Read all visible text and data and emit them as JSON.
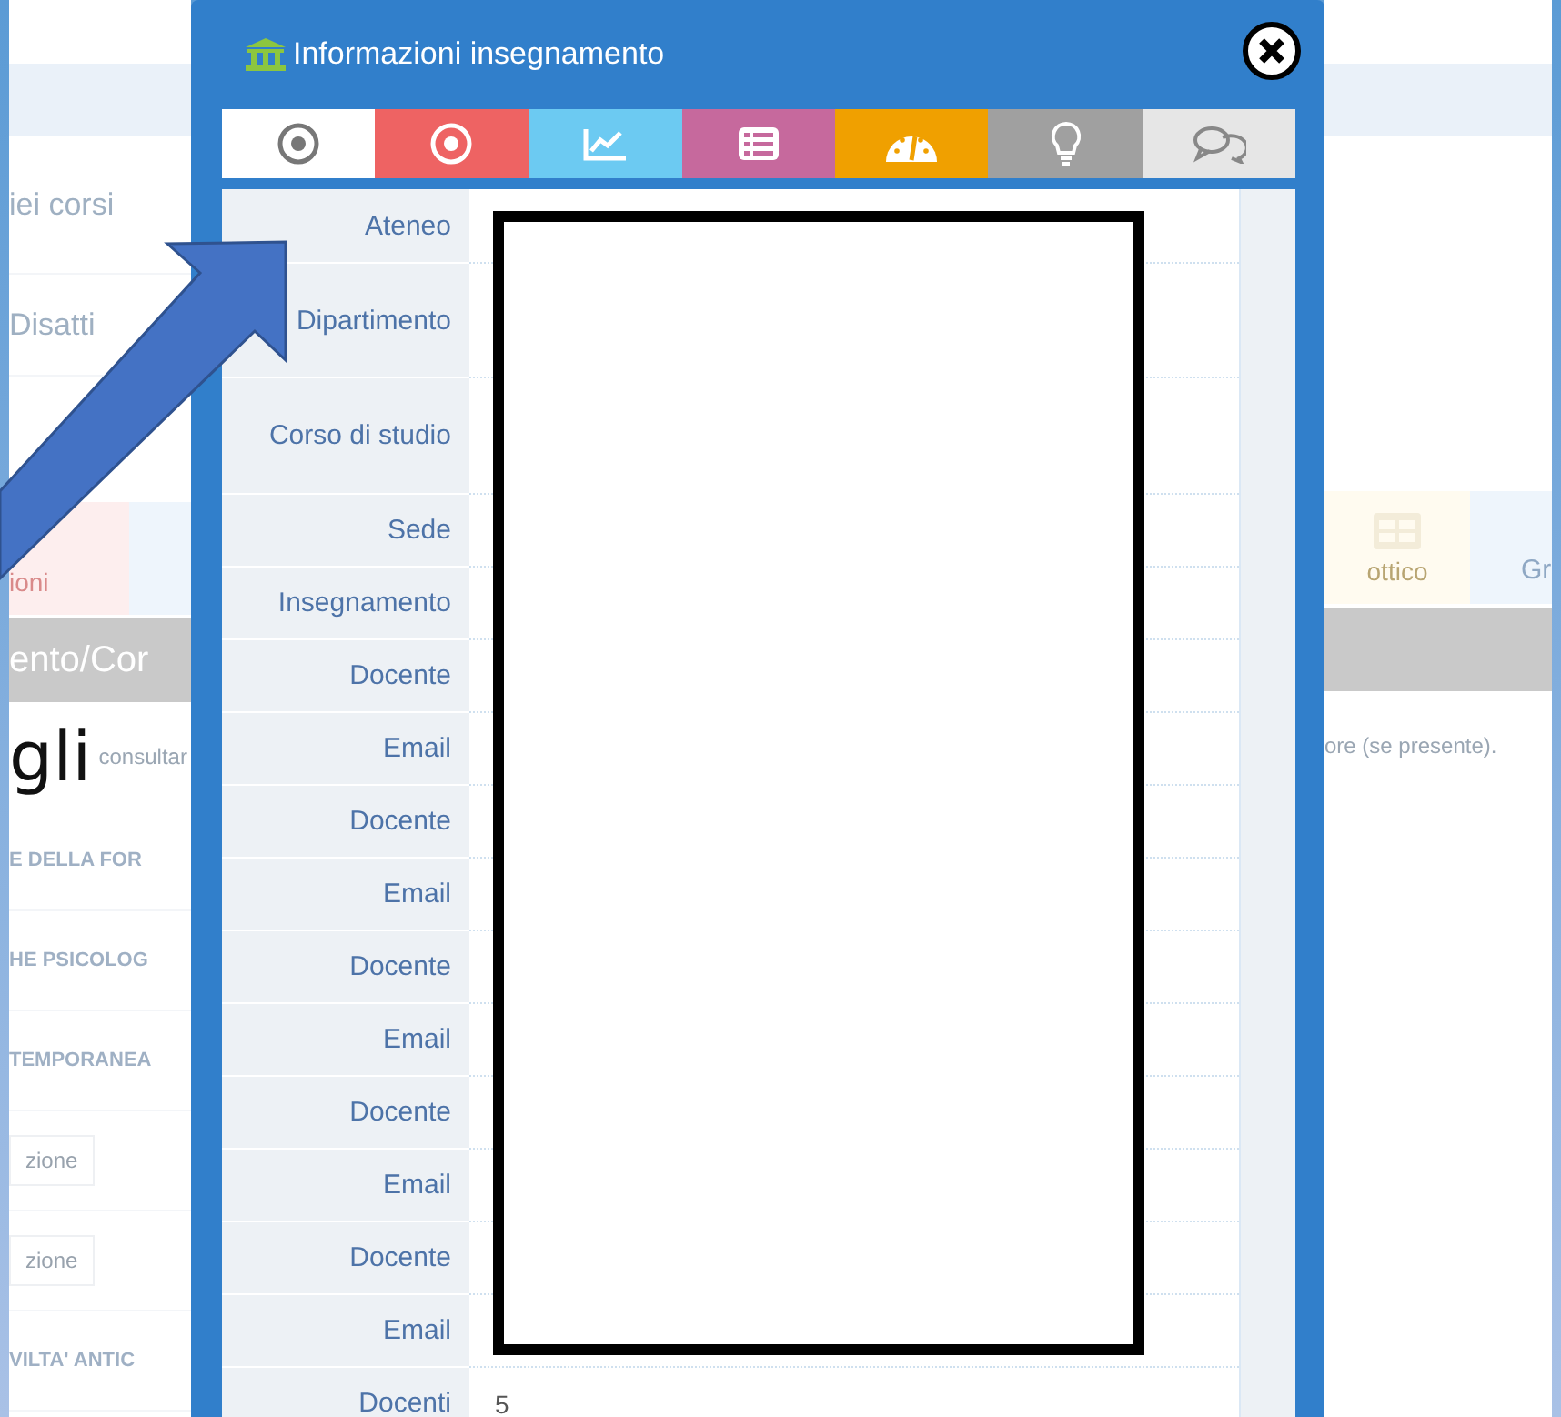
{
  "background_page": {
    "left": {
      "courses": "iei corsi",
      "disable": "Disatti",
      "tab": "ioni",
      "heading": "ento/Cor",
      "hint": "consultar",
      "rows": [
        {
          "kind": "title",
          "text": "E DELLA FOR"
        },
        {
          "kind": "title",
          "text": "HE PSICOLOG"
        },
        {
          "kind": "title",
          "text": "TEMPORANEA"
        },
        {
          "kind": "button",
          "text": "zione"
        },
        {
          "kind": "button",
          "text": "zione"
        },
        {
          "kind": "title",
          "text": "VILTA' ANTIC"
        }
      ]
    },
    "right": {
      "tabs": [
        "ottico",
        "Gr"
      ],
      "hint": "ore (se presente)."
    }
  },
  "slide_text": "gli",
  "dialog": {
    "title": "Informazioni insegnamento",
    "tabs": [
      {
        "kind": "target",
        "color": "#ffffff",
        "selected": true
      },
      {
        "kind": "target",
        "color": "#ee6363",
        "selected": false
      },
      {
        "kind": "chart",
        "color": "#6ccaf2",
        "selected": false
      },
      {
        "kind": "list",
        "color": "#c6699d",
        "selected": false
      },
      {
        "kind": "gauge",
        "color": "#f0a000",
        "selected": false
      },
      {
        "kind": "bulb",
        "color": "#a0a0a0",
        "selected": false
      },
      {
        "kind": "chat",
        "color": "#e6e6e6",
        "selected": false
      }
    ],
    "rows": [
      {
        "label": "Ateneo"
      },
      {
        "label": "Dipartimento"
      },
      {
        "label": "Corso di studio"
      },
      {
        "label": "Sede"
      },
      {
        "label": "Insegnamento"
      },
      {
        "label": "Docente"
      },
      {
        "label": "Email"
      },
      {
        "label": "Docente"
      },
      {
        "label": "Email"
      },
      {
        "label": "Docente"
      },
      {
        "label": "Email"
      },
      {
        "label": "Docente"
      },
      {
        "label": "Email"
      },
      {
        "label": "Docente"
      },
      {
        "label": "Email"
      },
      {
        "label": "Docenti",
        "value": "5"
      }
    ]
  },
  "annotations": {
    "redaction_box": true,
    "arrow": true
  }
}
